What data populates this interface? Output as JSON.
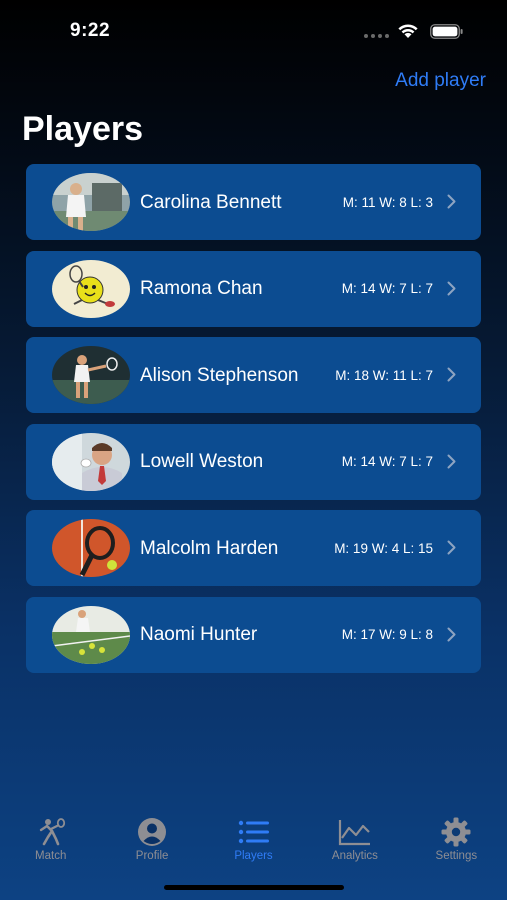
{
  "status_bar": {
    "time": "9:22"
  },
  "header": {
    "add_player_label": "Add player",
    "title": "Players"
  },
  "players": [
    {
      "name": "Carolina Bennett",
      "stats": "M: 11 W: 8 L: 3",
      "avatar": "photo"
    },
    {
      "name": "Ramona Chan",
      "stats": "M: 14 W: 7 L: 7",
      "avatar": "cartoon"
    },
    {
      "name": "Alison Stephenson",
      "stats": "M: 18 W: 11 L: 7",
      "avatar": "photo"
    },
    {
      "name": "Lowell Weston",
      "stats": "M: 14 W: 7 L: 7",
      "avatar": "photo"
    },
    {
      "name": "Malcolm Harden",
      "stats": "M: 19 W: 4 L: 15",
      "avatar": "racket"
    },
    {
      "name": "Naomi Hunter",
      "stats": "M: 17 W: 9 L: 8",
      "avatar": "photo"
    }
  ],
  "tab_bar": {
    "tabs": [
      {
        "label": "Match",
        "icon": "tennis-player-icon",
        "active": false
      },
      {
        "label": "Profile",
        "icon": "person-circle-icon",
        "active": false
      },
      {
        "label": "Players",
        "icon": "list-icon",
        "active": true
      },
      {
        "label": "Analytics",
        "icon": "chart-line-icon",
        "active": false
      },
      {
        "label": "Settings",
        "icon": "gear-icon",
        "active": false
      }
    ]
  },
  "colors": {
    "accent": "#2f7cf6",
    "row_background": "#0c4c91",
    "inactive_tab": "#8e8e93"
  }
}
